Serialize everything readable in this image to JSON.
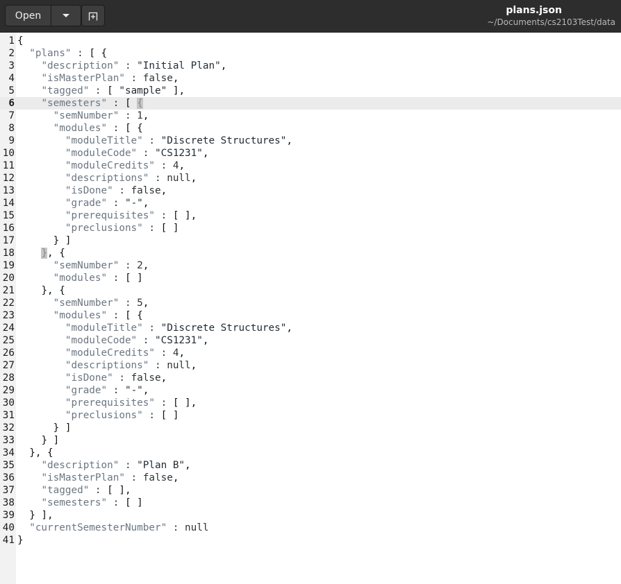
{
  "header": {
    "open_label": "Open",
    "title": "plans.json",
    "subtitle": "~/Documents/cs2103Test/data"
  },
  "editor": {
    "current_line": 6,
    "lines": [
      {
        "n": "1",
        "text": "{"
      },
      {
        "n": "2",
        "text": "  \"plans\" : [ {"
      },
      {
        "n": "3",
        "text": "    \"description\" : \"Initial Plan\","
      },
      {
        "n": "4",
        "text": "    \"isMasterPlan\" : false,"
      },
      {
        "n": "5",
        "text": "    \"tagged\" : [ \"sample\" ],"
      },
      {
        "n": "6",
        "text": "    \"semesters\" : [ {"
      },
      {
        "n": "7",
        "text": "      \"semNumber\" : 1,"
      },
      {
        "n": "8",
        "text": "      \"modules\" : [ {"
      },
      {
        "n": "9",
        "text": "        \"moduleTitle\" : \"Discrete Structures\","
      },
      {
        "n": "10",
        "text": "        \"moduleCode\" : \"CS1231\","
      },
      {
        "n": "11",
        "text": "        \"moduleCredits\" : 4,"
      },
      {
        "n": "12",
        "text": "        \"descriptions\" : null,"
      },
      {
        "n": "13",
        "text": "        \"isDone\" : false,"
      },
      {
        "n": "14",
        "text": "        \"grade\" : \"-\","
      },
      {
        "n": "15",
        "text": "        \"prerequisites\" : [ ],"
      },
      {
        "n": "16",
        "text": "        \"preclusions\" : [ ]"
      },
      {
        "n": "17",
        "text": "      } ]"
      },
      {
        "n": "18",
        "text": "    }, {"
      },
      {
        "n": "19",
        "text": "      \"semNumber\" : 2,"
      },
      {
        "n": "20",
        "text": "      \"modules\" : [ ]"
      },
      {
        "n": "21",
        "text": "    }, {"
      },
      {
        "n": "22",
        "text": "      \"semNumber\" : 5,"
      },
      {
        "n": "23",
        "text": "      \"modules\" : [ {"
      },
      {
        "n": "24",
        "text": "        \"moduleTitle\" : \"Discrete Structures\","
      },
      {
        "n": "25",
        "text": "        \"moduleCode\" : \"CS1231\","
      },
      {
        "n": "26",
        "text": "        \"moduleCredits\" : 4,"
      },
      {
        "n": "27",
        "text": "        \"descriptions\" : null,"
      },
      {
        "n": "28",
        "text": "        \"isDone\" : false,"
      },
      {
        "n": "29",
        "text": "        \"grade\" : \"-\","
      },
      {
        "n": "30",
        "text": "        \"prerequisites\" : [ ],"
      },
      {
        "n": "31",
        "text": "        \"preclusions\" : [ ]"
      },
      {
        "n": "32",
        "text": "      } ]"
      },
      {
        "n": "33",
        "text": "    } ]"
      },
      {
        "n": "34",
        "text": "  }, {"
      },
      {
        "n": "35",
        "text": "    \"description\" : \"Plan B\","
      },
      {
        "n": "36",
        "text": "    \"isMasterPlan\" : false,"
      },
      {
        "n": "37",
        "text": "    \"tagged\" : [ ],"
      },
      {
        "n": "38",
        "text": "    \"semesters\" : [ ]"
      },
      {
        "n": "39",
        "text": "  } ],"
      },
      {
        "n": "40",
        "text": "  \"currentSemesterNumber\" : null"
      },
      {
        "n": "41",
        "text": "}"
      }
    ]
  }
}
